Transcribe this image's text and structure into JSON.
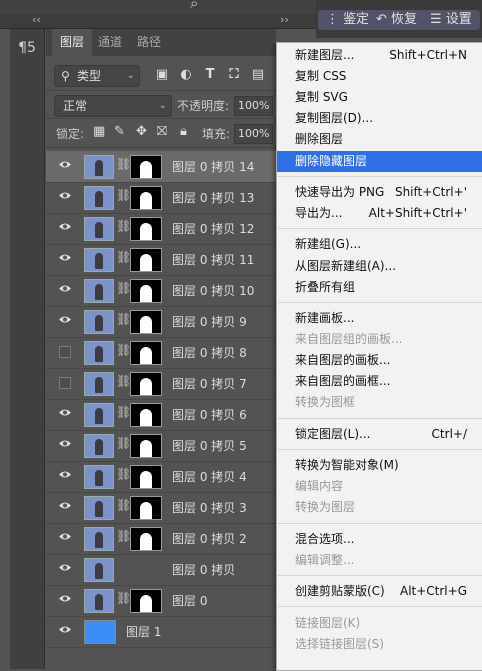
{
  "top": {
    "collapse_left": "‹‹",
    "collapse_right": "››",
    "buttons": [
      "鉴定",
      "恢复",
      "设置"
    ],
    "button_icons": [
      "menu-dots-icon",
      "undo-icon",
      "settings-icon"
    ]
  },
  "panel": {
    "tabs": [
      "图层",
      "通道",
      "路径"
    ],
    "filter_label": "类型",
    "filter_icons": [
      "image-filter-icon",
      "adjustment-filter-icon",
      "text-filter-icon",
      "shape-filter-icon",
      "smart-object-filter-icon"
    ],
    "blend_mode": "正常",
    "opacity_label": "不透明度:",
    "opacity_value": "100%",
    "lock_label": "锁定:",
    "lock_icons": [
      "lock-transparent-icon",
      "lock-image-icon",
      "lock-position-icon",
      "lock-artboard-icon",
      "lock-all-icon"
    ],
    "fill_label": "填充:",
    "fill_value": "100%"
  },
  "layers": [
    {
      "name": "图层 0 拷贝 14",
      "visible": true,
      "selected": true,
      "type": "masked"
    },
    {
      "name": "图层 0 拷贝 13",
      "visible": true,
      "selected": false,
      "type": "masked"
    },
    {
      "name": "图层 0 拷贝 12",
      "visible": true,
      "selected": false,
      "type": "masked"
    },
    {
      "name": "图层 0 拷贝 11",
      "visible": true,
      "selected": false,
      "type": "masked"
    },
    {
      "name": "图层 0 拷贝 10",
      "visible": true,
      "selected": false,
      "type": "masked"
    },
    {
      "name": "图层 0 拷贝 9",
      "visible": true,
      "selected": false,
      "type": "masked"
    },
    {
      "name": "图层 0 拷贝 8",
      "visible": false,
      "selected": false,
      "type": "masked"
    },
    {
      "name": "图层 0 拷贝 7",
      "visible": false,
      "selected": false,
      "type": "masked"
    },
    {
      "name": "图层 0 拷贝 6",
      "visible": true,
      "selected": false,
      "type": "masked"
    },
    {
      "name": "图层 0 拷贝 5",
      "visible": true,
      "selected": false,
      "type": "masked"
    },
    {
      "name": "图层 0 拷贝 4",
      "visible": true,
      "selected": false,
      "type": "masked"
    },
    {
      "name": "图层 0 拷贝 3",
      "visible": true,
      "selected": false,
      "type": "masked"
    },
    {
      "name": "图层 0 拷贝 2",
      "visible": true,
      "selected": false,
      "type": "masked"
    },
    {
      "name": "图层 0 拷贝",
      "visible": true,
      "selected": false,
      "type": "plain"
    },
    {
      "name": "图层 0",
      "visible": true,
      "selected": false,
      "type": "masked"
    },
    {
      "name": "图层 1",
      "visible": true,
      "selected": false,
      "type": "solid"
    }
  ],
  "menu": {
    "items": [
      {
        "label": "新建图层...",
        "shortcut": "Shift+Ctrl+N",
        "disabled": false
      },
      {
        "label": "复制 CSS",
        "shortcut": "",
        "disabled": false
      },
      {
        "label": "复制 SVG",
        "shortcut": "",
        "disabled": false
      },
      {
        "label": "复制图层(D)...",
        "shortcut": "",
        "disabled": false
      },
      {
        "label": "删除图层",
        "shortcut": "",
        "disabled": false
      },
      {
        "label": "删除隐藏图层",
        "shortcut": "",
        "disabled": false,
        "highlighted": true
      },
      {
        "sep": true
      },
      {
        "label": "快速导出为 PNG",
        "shortcut": "Shift+Ctrl+'",
        "disabled": false
      },
      {
        "label": "导出为...",
        "shortcut": "Alt+Shift+Ctrl+'",
        "disabled": false
      },
      {
        "sep": true
      },
      {
        "label": "新建组(G)...",
        "shortcut": "",
        "disabled": false
      },
      {
        "label": "从图层新建组(A)...",
        "shortcut": "",
        "disabled": false
      },
      {
        "label": "折叠所有组",
        "shortcut": "",
        "disabled": false
      },
      {
        "sep": true
      },
      {
        "label": "新建画板...",
        "shortcut": "",
        "disabled": false
      },
      {
        "label": "来自图层组的画板...",
        "shortcut": "",
        "disabled": true
      },
      {
        "label": "来自图层的画板...",
        "shortcut": "",
        "disabled": false
      },
      {
        "label": "来自图层的画框...",
        "shortcut": "",
        "disabled": false
      },
      {
        "label": "转换为图框",
        "shortcut": "",
        "disabled": true
      },
      {
        "sep": true
      },
      {
        "label": "锁定图层(L)...",
        "shortcut": "Ctrl+/",
        "disabled": false
      },
      {
        "sep": true
      },
      {
        "label": "转换为智能对象(M)",
        "shortcut": "",
        "disabled": false
      },
      {
        "label": "编辑内容",
        "shortcut": "",
        "disabled": true
      },
      {
        "label": "转换为图层",
        "shortcut": "",
        "disabled": true
      },
      {
        "sep": true
      },
      {
        "label": "混合选项...",
        "shortcut": "",
        "disabled": false
      },
      {
        "label": "编辑调整...",
        "shortcut": "",
        "disabled": true
      },
      {
        "sep": true
      },
      {
        "label": "创建剪贴蒙版(C)",
        "shortcut": "Alt+Ctrl+G",
        "disabled": false
      },
      {
        "sep": true
      },
      {
        "label": "链接图层(K)",
        "shortcut": "",
        "disabled": true
      },
      {
        "label": "选择链接图层(S)",
        "shortcut": "",
        "disabled": true
      }
    ]
  }
}
